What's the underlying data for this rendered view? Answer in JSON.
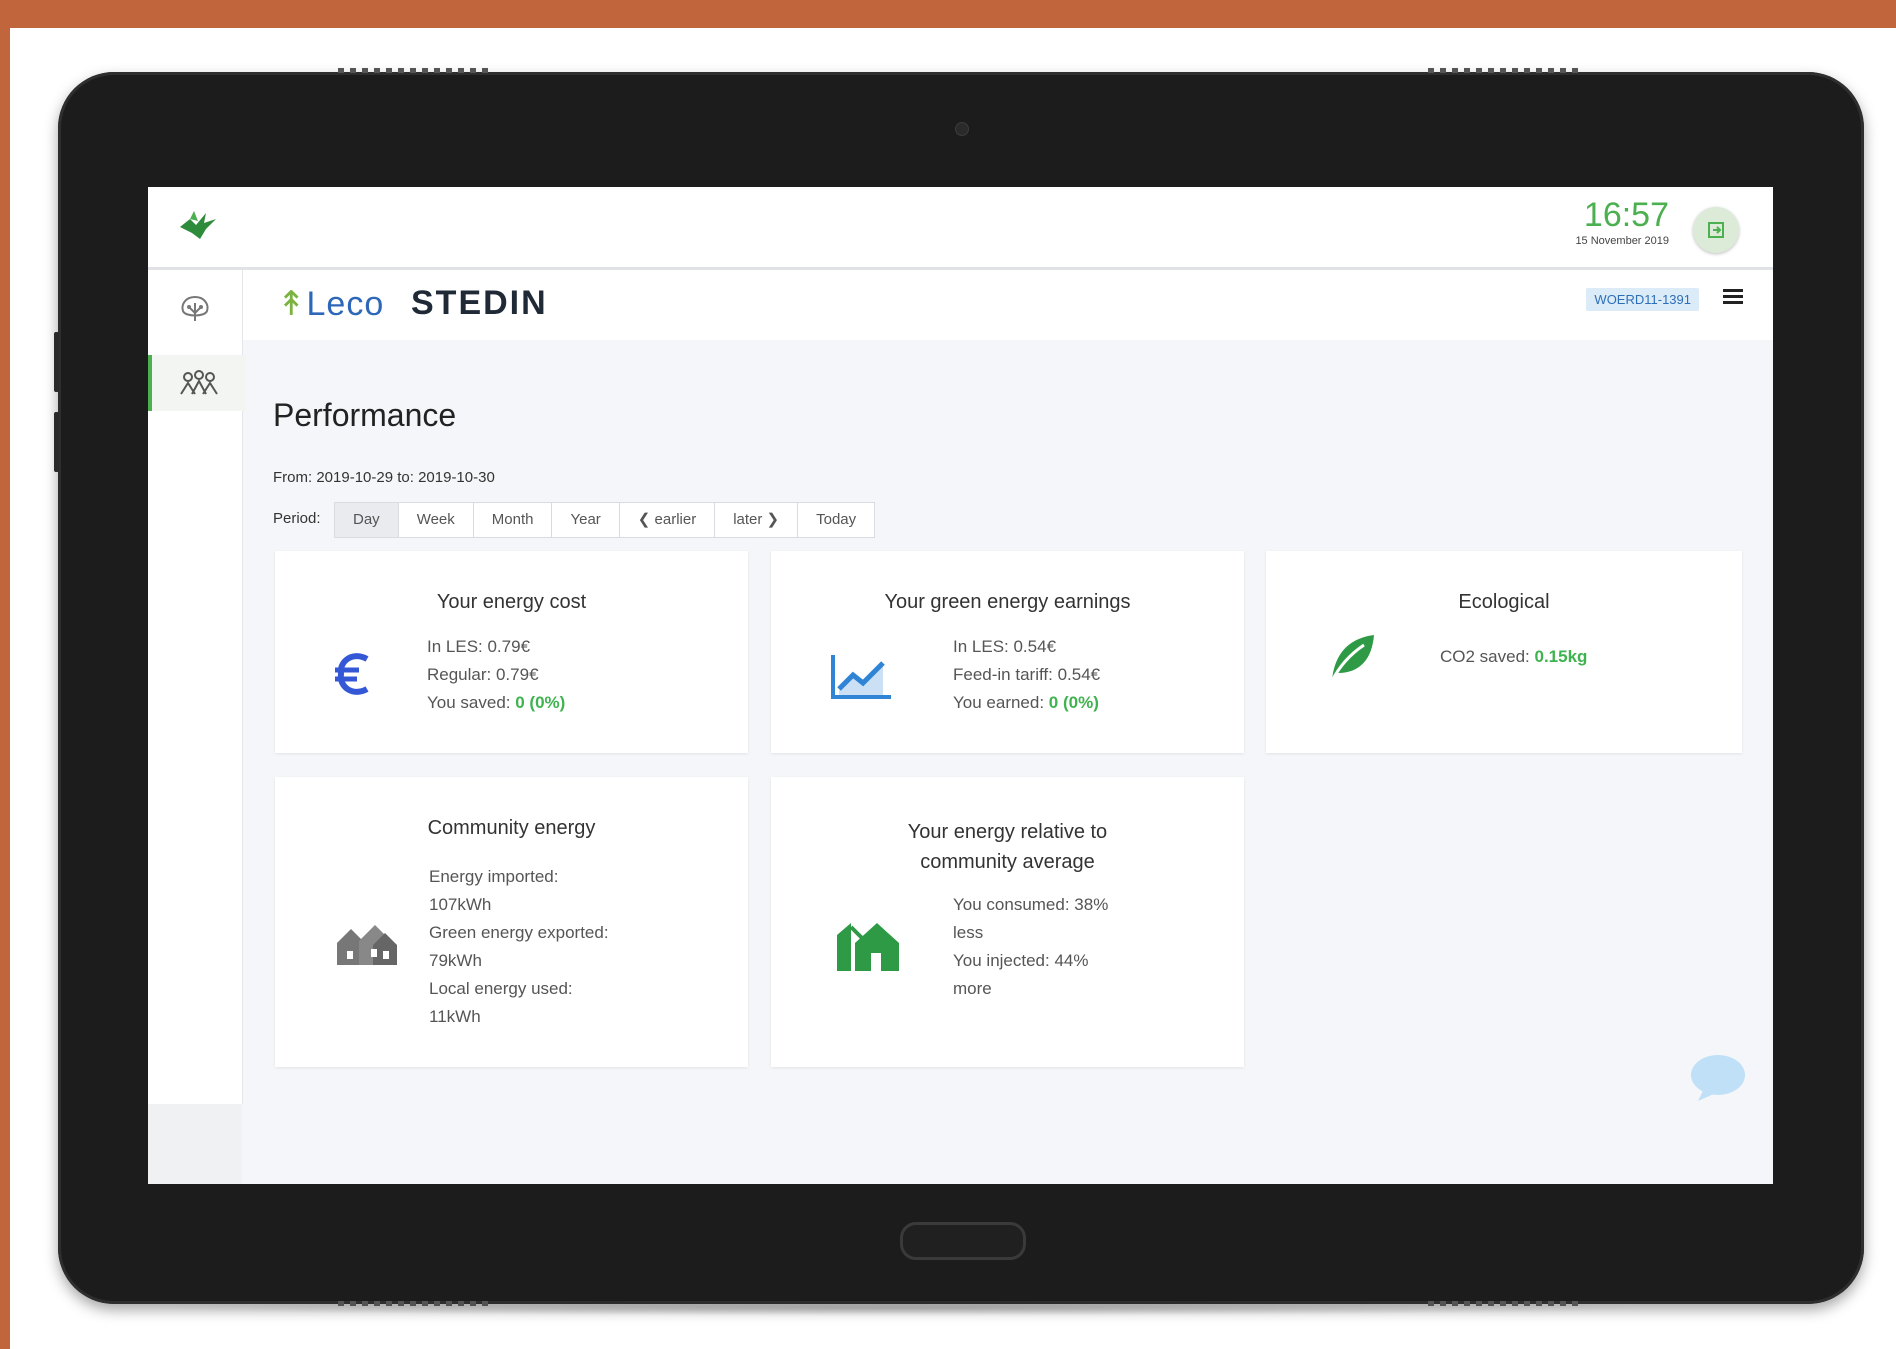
{
  "clock": {
    "time": "16:57",
    "date": "15 November 2019"
  },
  "header": {
    "brand_leco": "Leco",
    "brand_stedin": "STEDIN",
    "user_id": "WOERD11-1391"
  },
  "page": {
    "title": "Performance",
    "date_range": "From: 2019-10-29 to: 2019-10-30",
    "period_label": "Period:",
    "period_buttons": [
      "Day",
      "Week",
      "Month",
      "Year",
      "❮ earlier",
      "later ❯",
      "Today"
    ],
    "active_period": "Day"
  },
  "cards": {
    "energy_cost": {
      "title": "Your energy cost",
      "line1": "In LES: 0.79€",
      "line2": "Regular: 0.79€",
      "line3_label": "You saved: ",
      "line3_value": "0 (0%)"
    },
    "green_earnings": {
      "title": "Your green energy earnings",
      "line1": "In LES: 0.54€",
      "line2": "Feed-in tariff: 0.54€",
      "line3_label": "You earned: ",
      "line3_value": "0 (0%)"
    },
    "ecological": {
      "title": "Ecological",
      "line1_label": "CO2 saved: ",
      "line1_value": "0.15kg"
    },
    "community": {
      "title": "Community energy",
      "line1": "Energy imported:",
      "line2": "107kWh",
      "line3": "Green energy exported:",
      "line4": "79kWh",
      "line5": "Local energy used:",
      "line6": "11kWh"
    },
    "relative": {
      "title_line1": "Your energy relative to",
      "title_line2": "community average",
      "line1": "You consumed: 38%",
      "line2": "less",
      "line3": "You injected: 44%",
      "line4": "more"
    }
  },
  "icons": {
    "logo": "bird-logo-icon",
    "exit": "exit-icon",
    "nav1": "tree-network-icon",
    "nav2": "community-icon",
    "euro": "euro-icon",
    "chart": "line-chart-icon",
    "leaf": "leaf-icon",
    "houses": "houses-icon",
    "house_building": "house-building-icon",
    "chat": "chat-bubble-icon"
  },
  "colors": {
    "accent_green": "#4caf50",
    "value_green": "#3fb34f",
    "euro_blue": "#3457d5",
    "frame": "#c0653c"
  }
}
